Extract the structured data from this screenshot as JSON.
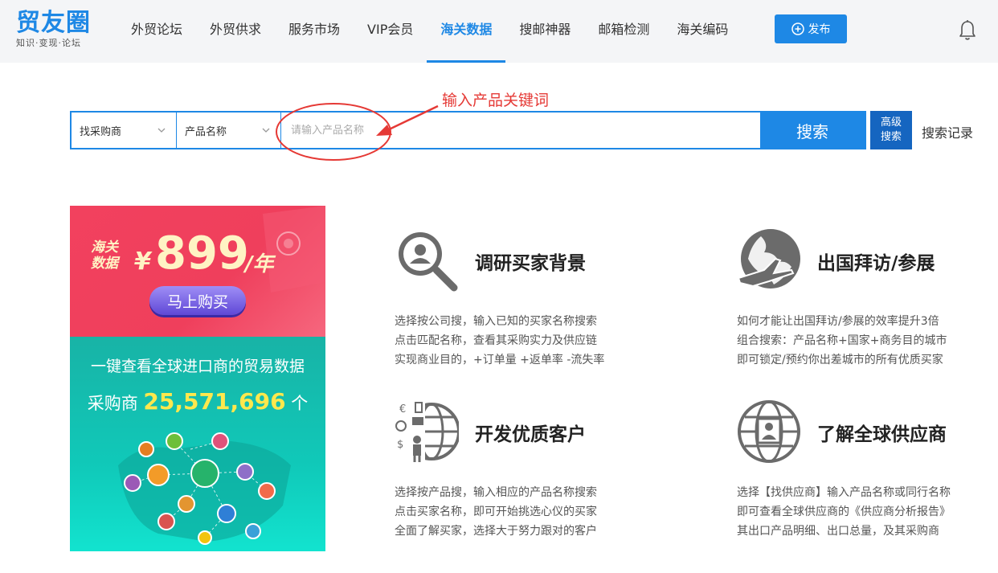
{
  "logo": {
    "main": "贸友圈",
    "sub": "知识·变现·论坛"
  },
  "nav": {
    "items": [
      {
        "label": "外贸论坛",
        "active": false
      },
      {
        "label": "外贸供求",
        "active": false
      },
      {
        "label": "服务市场",
        "active": false
      },
      {
        "label": "VIP会员",
        "active": false
      },
      {
        "label": "海关数据",
        "active": true
      },
      {
        "label": "搜邮神器",
        "active": false
      },
      {
        "label": "邮箱检测",
        "active": false
      },
      {
        "label": "海关编码",
        "active": false
      }
    ],
    "publish_label": "发布",
    "bell_icon": "bell-icon",
    "accent_color": "#1e88e5"
  },
  "annotation": {
    "text": "输入产品关键词",
    "color": "#e53935"
  },
  "search": {
    "type_select": "找采购商",
    "field_select": "产品名称",
    "placeholder": "请输入产品名称",
    "value": "",
    "button_label": "搜索",
    "advanced_label_line1": "高级",
    "advanced_label_line2": "搜索",
    "history_label": "搜索记录"
  },
  "banner": {
    "tag_line1": "海关",
    "tag_line2": "数据",
    "currency": "¥",
    "price": "899",
    "unit": "/年",
    "buy_label": "马上购买",
    "headline": "一键查看全球进口商的贸易数据",
    "buyers_prefix": "采购商",
    "buyers_count": "25,571,696",
    "buyers_suffix": "个",
    "top_color": "#f2415e",
    "bottom_color": "#18b3a6"
  },
  "features": [
    {
      "icon": "magnifier-person-icon",
      "title": "调研买家背景",
      "lines": [
        "选择按公司搜，输入已知的买家名称搜索",
        "点击匹配名称，查看其采购实力及供应链",
        "实现商业目的，+订单量 +返单率 -流失率"
      ]
    },
    {
      "icon": "globe-plane-icon",
      "title": "出国拜访/参展",
      "lines": [
        "如何才能让出国拜访/参展的效率提升3倍",
        "组合搜索：产品名称+国家+商务目的城市",
        "即可锁定/预约你出差城市的所有优质买家"
      ]
    },
    {
      "icon": "globe-commerce-icon",
      "title": "开发优质客户",
      "lines": [
        "选择按产品搜，输入相应的产品名称搜索",
        "点击买家名称，即可开始挑选心仪的买家",
        "全面了解买家，选择大于努力跟对的客户"
      ]
    },
    {
      "icon": "globe-supplier-icon",
      "title": "了解全球供应商",
      "lines": [
        "选择【找供应商】输入产品名称或同行名称",
        "即可查看全球供应商的《供应商分析报告》",
        "其出口产品明细、出口总量，及其采购商"
      ]
    }
  ]
}
